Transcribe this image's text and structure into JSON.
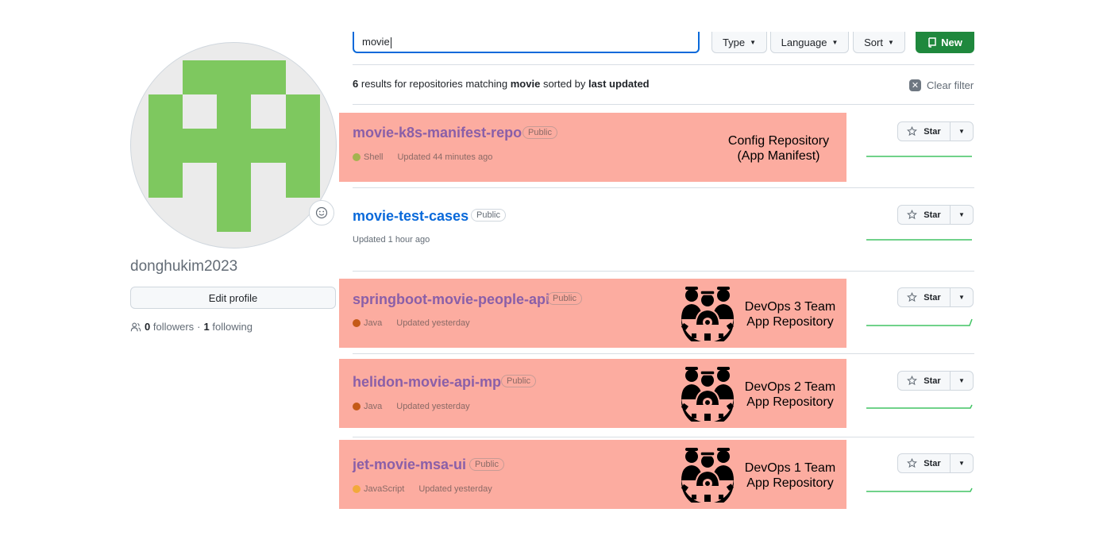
{
  "profile": {
    "username": "donghukim2023",
    "edit_profile_label": "Edit profile",
    "followers_count": "0",
    "followers_label": "followers",
    "separator": "·",
    "following_count": "1",
    "following_label": "following",
    "avatar_color": "#7ec85f"
  },
  "toolbar": {
    "search_value": "movie",
    "type_label": "Type",
    "language_label": "Language",
    "sort_label": "Sort",
    "new_label": "New"
  },
  "results": {
    "count": "6",
    "text1": "results for repositories matching",
    "query": "movie",
    "text2": "sorted by",
    "sort": "last updated",
    "clear_filter": "Clear filter"
  },
  "repos": [
    {
      "name": "movie-k8s-manifest-repo",
      "visibility": "Public",
      "language": "Shell",
      "lang_color": "#89e051",
      "updated": "Updated 44 minutes ago",
      "star_label": "Star"
    },
    {
      "name": "movie-test-cases",
      "visibility": "Public",
      "language": "",
      "lang_color": "",
      "updated": "Updated 1 hour ago",
      "star_label": "Star"
    },
    {
      "name": "springboot-movie-people-api",
      "visibility": "Public",
      "language": "Java",
      "lang_color": "#b07219",
      "updated": "Updated yesterday",
      "star_label": "Star"
    },
    {
      "name": "helidon-movie-api-mp",
      "visibility": "Public",
      "language": "Java",
      "lang_color": "#b07219",
      "updated": "Updated yesterday",
      "star_label": "Star"
    },
    {
      "name": "jet-movie-msa-ui",
      "visibility": "Public",
      "language": "JavaScript",
      "lang_color": "#f1e05a",
      "updated": "Updated yesterday",
      "star_label": "Star"
    }
  ],
  "annotations": {
    "config": "Config Repository\n(App Manifest)",
    "team3": "DevOps 3 Team\nApp Repository",
    "team2": "DevOps 2 Team\nApp Repository",
    "team1": "DevOps 1 Team\nApp Repository",
    "highlight_color": "#fcaca0"
  },
  "colors": {
    "link": "#0969da",
    "primary_button": "#1f883d",
    "sparkline": "#40c463"
  }
}
